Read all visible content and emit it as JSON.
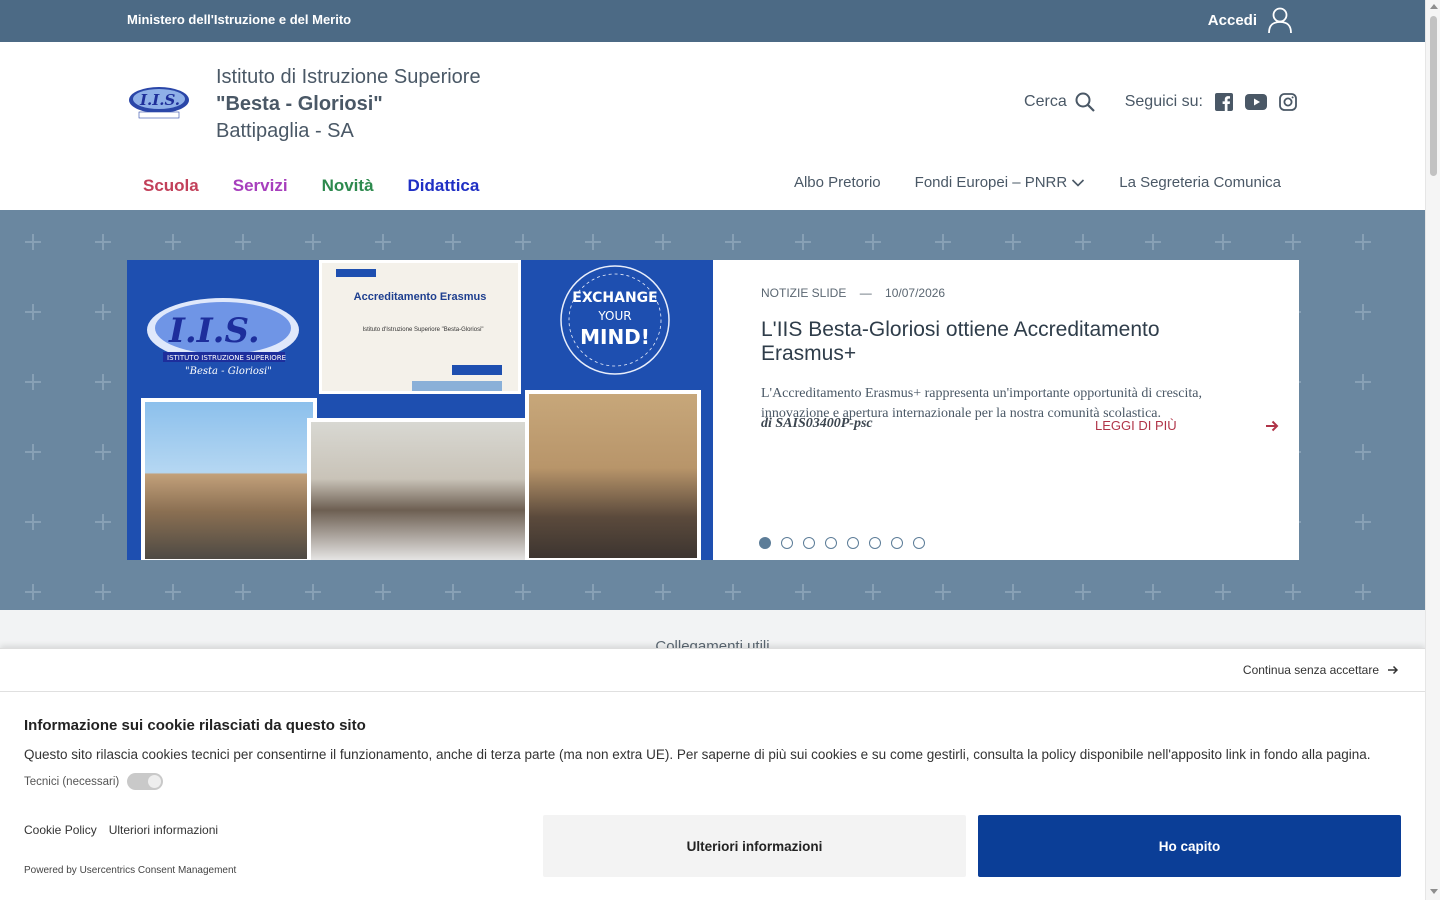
{
  "topbar": {
    "ministry": "Ministero dell'Istruzione e del Merito",
    "login_label": "Accedi"
  },
  "header": {
    "name_line1": "Istituto di Istruzione Superiore",
    "name_line2": "\"Besta - Gloriosi\"",
    "name_line3": "Battipaglia - SA",
    "search_label": "Cerca",
    "follow_label": "Seguici su:"
  },
  "main_nav": [
    "Scuola",
    "Servizi",
    "Novità",
    "Didattica"
  ],
  "secondary_nav": [
    "Albo Pretorio",
    "Fondi Europei – PNRR",
    "La Segreteria Comunica"
  ],
  "hero": {
    "category": "NOTIZIE SLIDE",
    "separator": "—",
    "date": "10/07/2026",
    "title": "L'IIS Besta-Gloriosi ottiene Accreditamento Erasmus+",
    "excerpt": "L'Accreditamento Erasmus+ rappresenta un'importante opportunità di crescita, innovazione e apertura internazionale per la nostra comunità scolastica.",
    "author": "di SAIS03400P-psc",
    "read_more": "LEGGI DI PIÙ",
    "slide_count": 8,
    "active_slide": 1,
    "image_texts": {
      "logo_main": "I.I.S.",
      "logo_sub": "ISTITUTO ISTRUZIONE SUPERIORE",
      "logo_name": "\"Besta - Gloriosi\"",
      "cert_title": "Accreditamento Erasmus",
      "cert_name": "Istituto d'Istruzione Superiore \"Besta-Gloriosi\"",
      "badge_line1": "EXCHANGE",
      "badge_line2": "YOUR",
      "badge_line3": "MIND!"
    }
  },
  "links_section": {
    "title": "Collegamenti utili"
  },
  "cookie": {
    "continue_label": "Continua senza accettare",
    "title": "Informazione sui cookie rilasciati da questo sito",
    "description": "Questo sito rilascia cookies tecnici per consentirne il funzionamento, anche di terza parte (ma non extra UE). Per saperne di più sui cookies e su come gestirli, consulta la policy disponibile nell'apposito link in fondo alla pagina.",
    "technical_label": "Tecnici (necessari)",
    "policy_link": "Cookie Policy",
    "more_link": "Ulteriori informazioni",
    "powered_by": "Powered by Usercentrics Consent Management",
    "btn_more": "Ulteriori informazioni",
    "btn_accept": "Ho capito"
  },
  "colors": {
    "topbar": "#4c6a85",
    "hero_bg": "#6a87a0",
    "accept_button": "#0b3e97",
    "read_more": "#b03448"
  }
}
